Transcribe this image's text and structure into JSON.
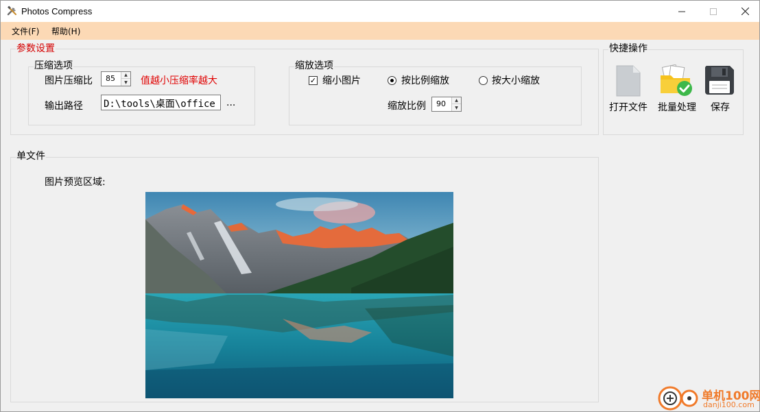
{
  "window": {
    "title": "Photos Compress",
    "controls": {
      "minimize": "—",
      "maximize": "☐",
      "close": "✕"
    }
  },
  "menu": {
    "file": "文件(F)",
    "help": "帮助(H)"
  },
  "params": {
    "legend": "参数设置",
    "legend_color": "#d40000",
    "compress": {
      "legend": "压缩选项",
      "ratio_label": "图片压缩比",
      "ratio_value": "85",
      "hint": "值越小压缩率越大",
      "hint_color": "#e00000",
      "output_label": "输出路径",
      "output_value": "D:\\tools\\桌面\\office",
      "browse_label": "..."
    },
    "scale": {
      "legend": "缩放选项",
      "shrink_label": "缩小图片",
      "shrink_checked": true,
      "by_ratio_label": "按比例缩放",
      "by_size_label": "按大小缩放",
      "selected_mode": "by_ratio",
      "ratio_label": "缩放比例",
      "ratio_value": "90"
    }
  },
  "quick": {
    "legend": "快捷操作",
    "open_label": "打开文件",
    "batch_label": "批量处理",
    "save_label": "保存"
  },
  "single": {
    "legend": "单文件",
    "preview_label": "图片预览区域:"
  },
  "watermark": {
    "brand": "单机100网",
    "domain": "danji100.com"
  }
}
